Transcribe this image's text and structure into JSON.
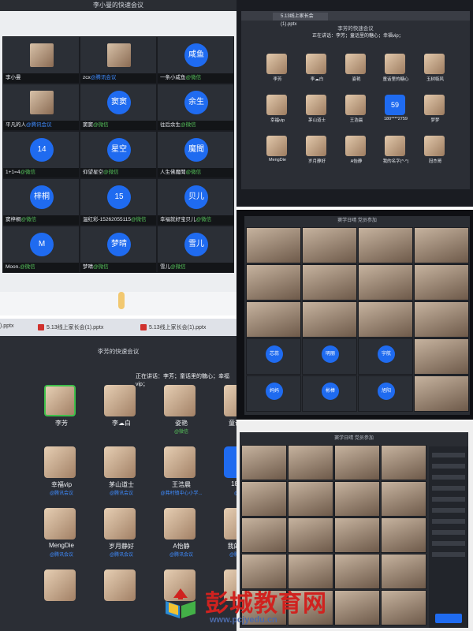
{
  "panel1": {
    "title": "李小曼的快速会议",
    "tiles": [
      {
        "type": "photo",
        "name": "李小曼",
        "suffix": ""
      },
      {
        "type": "photo",
        "name": "zcx",
        "suffix": "@腾讯会议",
        "suffix_color": "mt"
      },
      {
        "type": "circle",
        "label": "咸鱼",
        "name": "一条小咸鱼",
        "suffix": "@微信",
        "suffix_color": "wx"
      },
      {
        "type": "photo",
        "name": "平凡的人",
        "suffix": "@腾讯会议",
        "suffix_color": "mt"
      },
      {
        "type": "circle",
        "label": "窦窦",
        "name": "窦窦",
        "suffix": "@微信",
        "suffix_color": "wx"
      },
      {
        "type": "circle",
        "label": "余生",
        "name": "往后余生",
        "suffix": "@微信",
        "suffix_color": "wx"
      },
      {
        "type": "circle",
        "label": "14",
        "name": "1+1=4",
        "suffix": "@微信",
        "suffix_color": "wx"
      },
      {
        "type": "circle",
        "label": "星空",
        "name": "仰望星空",
        "suffix": "@微信",
        "suffix_color": "wx"
      },
      {
        "type": "circle",
        "label": "魔聞",
        "name": "人生佛魔聞",
        "suffix": "@微信",
        "suffix_color": "wx"
      },
      {
        "type": "circle",
        "label": "梓桐",
        "name": "窦梓桐",
        "suffix": "@微信",
        "suffix_color": "wx"
      },
      {
        "type": "circle",
        "label": "15",
        "name": "温红彩-15262055115",
        "suffix": "@微信",
        "suffix_color": "wx"
      },
      {
        "type": "circle",
        "label": "贝儿",
        "name": "幸福就好宝贝儿",
        "suffix": "@微信",
        "suffix_color": "wx"
      },
      {
        "type": "circle",
        "label": "M",
        "name": "Moon.",
        "suffix": "@微信",
        "suffix_color": "wx"
      },
      {
        "type": "circle",
        "label": "梦晴",
        "name": "梦晴",
        "suffix": "@微信",
        "suffix_color": "wx"
      },
      {
        "type": "circle",
        "label": "雪儿",
        "name": "雪儿",
        "suffix": "@微信",
        "suffix_color": "wx"
      }
    ]
  },
  "panel2": {
    "tab": "5.13线上家长会(1).pptx",
    "title": "李芳的快速会议",
    "speaking": "正在讲话：李芳；童话里的糖心；幸福vip；",
    "tiles": [
      {
        "type": "photo",
        "name": "李芳"
      },
      {
        "type": "photo",
        "name": "李☁白"
      },
      {
        "type": "photo",
        "name": "姿艳"
      },
      {
        "type": "photo",
        "name": "童话里的糖心"
      },
      {
        "type": "photo",
        "name": "玉树临风"
      },
      {
        "type": "photo",
        "name": "幸福vip"
      },
      {
        "type": "photo",
        "name": "茅山道士"
      },
      {
        "type": "photo",
        "name": "王浩晨"
      },
      {
        "type": "num",
        "label": "59",
        "name": "180****2759"
      },
      {
        "type": "photo",
        "name": "梦梦"
      },
      {
        "type": "photo",
        "name": "MengDie"
      },
      {
        "type": "photo",
        "name": "岁月静好"
      },
      {
        "type": "photo",
        "name": "A怡静"
      },
      {
        "type": "photo",
        "name": "我的名字(^-^)"
      },
      {
        "type": "photo",
        "name": "冠杰哥"
      }
    ]
  },
  "panel3": {
    "title": "窦学日晴  党员参加",
    "circles": [
      "芯蕊",
      "明丽",
      "宇航",
      "妈妈",
      "彬棒",
      "旭阳"
    ]
  },
  "panel4": {
    "tab0": ").pptx",
    "tab1": "5.13线上家长会(1).pptx",
    "tab2": "5.13线上家长会(1).pptx",
    "title": "李芳的快速会议",
    "speaking": "正在讲话：李芳；童话里的糖心；幸福vip；",
    "tiles": [
      {
        "type": "photo",
        "name": "李芳",
        "sub": "",
        "active": true
      },
      {
        "type": "photo",
        "name": "李☁白",
        "sub": ""
      },
      {
        "type": "photo",
        "name": "姿艳",
        "sub": "@微信",
        "sub_wx": true
      },
      {
        "type": "photo",
        "name": "童话里的",
        "sub": ""
      },
      {
        "type": "photo",
        "name": "幸福vip",
        "sub": "@腾讯会议"
      },
      {
        "type": "photo",
        "name": "茅山道士",
        "sub": "@腾讯会议"
      },
      {
        "type": "photo",
        "name": "王浩晨",
        "sub": "@弗村镇中心小学..."
      },
      {
        "type": "num",
        "label": "5",
        "name": "180****",
        "sub": "@腾讯"
      },
      {
        "type": "photo",
        "name": "MengDie",
        "sub": "@腾讯会议"
      },
      {
        "type": "photo",
        "name": "岁月静好",
        "sub": "@腾讯会议"
      },
      {
        "type": "photo",
        "name": "A怡静",
        "sub": "@腾讯会议"
      },
      {
        "type": "photo",
        "name": "我的名字(",
        "sub": "@腾讯会议"
      }
    ]
  },
  "panel5": {
    "title": "窦学日晴  党员参加"
  },
  "watermark": {
    "name": "彭城教育网",
    "url": "www.pcjyedu.cn"
  },
  "colors": {
    "accent_blue": "#1f6bf0",
    "wechat_green": "#55c25a",
    "meeting_blue": "#3f8cff",
    "watermark_red": "#d0221f"
  }
}
